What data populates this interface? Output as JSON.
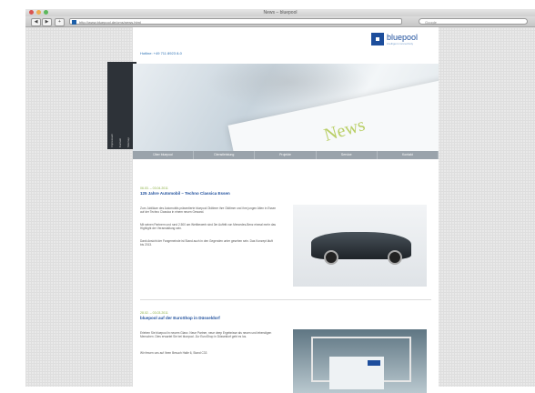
{
  "window": {
    "title": "News – bluepool"
  },
  "toolbar": {
    "url": "http://www.bluepool.de/cms/news.html",
    "search_placeholder": "Google",
    "back": "◀",
    "forward": "▶",
    "add": "+"
  },
  "site": {
    "hotline": "Hotline: +49 711 8923 8-0",
    "logo": {
      "name": "bluepool",
      "tagline": "intelligent connectivity"
    },
    "hero": {
      "headline": "News"
    },
    "side_tabs": [
      "Impressum",
      "Kontakt",
      "Sitemap"
    ],
    "nav": [
      "Über bluepool",
      "Dienstleistung",
      "Projekte",
      "Service",
      "Kontakt"
    ],
    "entries": [
      {
        "date": "06.03. – 03.04.2011",
        "title": "125 Jahre Automobil – Techno Classica Essen",
        "paragraphs": [
          "Zum Jubiläum des Automobils präsentierte bluepool Oldtimer ihre Oldtimer und ihre jungen Alten in Essen auf der Techno Classica in einem neuen Gewand.",
          "Mit seinen Partnern und rund 2.500 am Wettbewerb sind 3er Auftritt von Mercedes-Benz einmal mehr das Highlight der Veranstaltung sein.",
          "Dank Ansicht der Fangemeinde ist Stand auch in den Gegenden unter gesehen sein. Das Konzept läuft bis 2013."
        ]
      },
      {
        "date": "28.02. – 03.03.2011",
        "title": "bluepool auf der EuroShop in Düsseldorf",
        "paragraphs": [
          "Erleben Sie bluepool in neuem Glanz. Neue Partner, neue deep Ergebnisse als neuen und lebendigen Menschen. Dies erwartet Sie bei bluepool. Zur EuroShop in Düsseldorf geht es los.",
          "Wir freuen uns auf Ihren Besuch Halle 6, Stand C33"
        ]
      }
    ]
  }
}
